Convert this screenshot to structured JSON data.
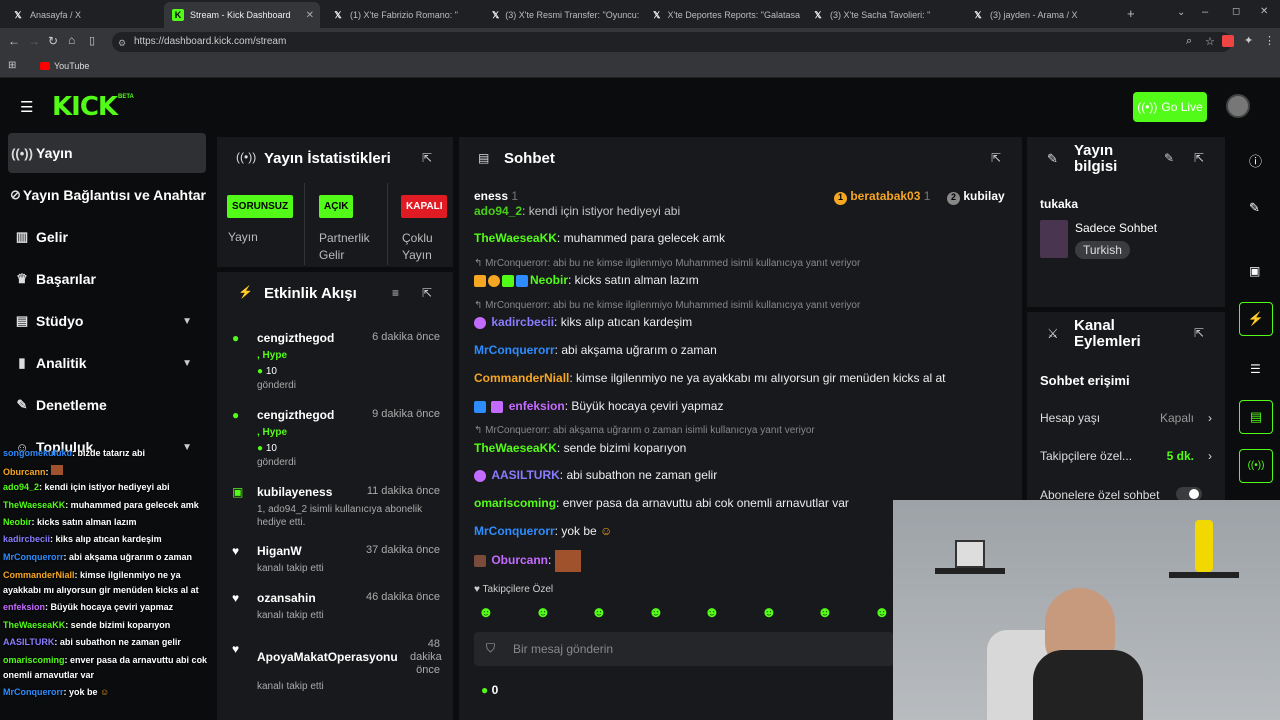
{
  "browser": {
    "tabs": [
      {
        "label": "Anasayfa / X",
        "icon": "x-logo"
      },
      {
        "label": "Stream - Kick Dashboard",
        "icon": "kick-logo"
      },
      {
        "label": "(1) X'te Fabrizio Romano: \"",
        "icon": "x-logo"
      },
      {
        "label": "(3) X'te Resmi Transfer: \"Oyuncu: Ej",
        "icon": "x-logo"
      },
      {
        "label": "X'te Deportes Reports: \"Galatasa",
        "icon": "x-logo"
      },
      {
        "label": "(3) X'te Sacha Tavolieri: \"",
        "icon": "x-logo"
      },
      {
        "label": "(3) jayden - Arama / X",
        "icon": "x-logo"
      }
    ],
    "url": "https://dashboard.kick.com/stream",
    "bookmark": "YouTube"
  },
  "header": {
    "logo": "KICK",
    "beta": "BETA",
    "go_live": "Go Live"
  },
  "sidebar": {
    "items": [
      {
        "label": "Yayın",
        "icon": "broadcast-icon"
      },
      {
        "label": "Yayın Bağlantısı ve Anahtar",
        "icon": "link-icon"
      },
      {
        "label": "Gelir",
        "icon": "bank-icon"
      },
      {
        "label": "Başarılar",
        "icon": "trophy-icon"
      },
      {
        "label": "Stüdyo",
        "icon": "wrench-icon"
      },
      {
        "label": "Analitik",
        "icon": "chart-icon"
      },
      {
        "label": "Denetleme",
        "icon": "sword-icon"
      },
      {
        "label": "Topluluk",
        "icon": "people-icon"
      }
    ]
  },
  "stats": {
    "title": "Yayın İstatistikleri",
    "badges": [
      {
        "badge": "SORUNSUZ",
        "label": "Yayın",
        "color": "#53fc18"
      },
      {
        "badge": "AÇIK",
        "label": "Partnerlik Gelir",
        "color": "#53fc18"
      },
      {
        "badge": "KAPALI",
        "label": "Çoklu Yayın",
        "color": "#e01b24"
      }
    ]
  },
  "activity": {
    "title": "Etkinlik Akışı",
    "items": [
      {
        "name": "cengizthegod",
        "time": "6 dakika önce",
        "line1": ", Hype",
        "line2": "10",
        "line3": "gönderdi",
        "icon": "kick-coin-icon"
      },
      {
        "name": "cengizthegod",
        "time": "9 dakika önce",
        "line1": ", Hype",
        "line2": "10",
        "line3": "gönderdi",
        "icon": "kick-coin-icon"
      },
      {
        "name": "kubilayeness",
        "time": "11 dakika önce",
        "line1": "1, ado94_2 isimli kullanıcıya abonelik",
        "line2": "hediye etti.",
        "icon": "gift-icon"
      },
      {
        "name": "HiganW",
        "time": "37 dakika önce",
        "line1": "kanalı takip etti",
        "icon": "heart-icon"
      },
      {
        "name": "ozansahin",
        "time": "46 dakika önce",
        "line1": "kanalı takip etti",
        "icon": "heart-icon"
      },
      {
        "name": "ApoyaMakatOperasyonu",
        "time": "48 dakika önce",
        "line1": "kanalı takip etti",
        "icon": "heart-icon"
      }
    ]
  },
  "chat": {
    "title": "Sohbet",
    "top_bar": {
      "left": "eness",
      "left_count": "1",
      "gifter1": "beratabak03",
      "gifter1_count": "1",
      "gifter2": "kubilay"
    },
    "messages": [
      {
        "user": "ado94_2",
        "text": ": kendi için istiyor hediyeyi abi",
        "color": "#53fc18"
      },
      {
        "user": "TheWaeseaKK",
        "text": ": muhammed para gelecek amk",
        "color": "#53fc18"
      },
      {
        "reply": "MrConquerorr: abi bu ne kimse ilgilenmiyo Muhammed isimli kullanıcıya yanıt veriyor"
      },
      {
        "user": "Neobir",
        "text": ": kicks satın alman lazım",
        "color": "#53fc18"
      },
      {
        "reply": "MrConquerorr: abi bu ne kimse ilgilenmiyo Muhammed isimli kullanıcıya yanıt veriyor"
      },
      {
        "user": "kadircbecii",
        "text": ": kiks alıp atıcan kardeşim",
        "color": "#8a7cff"
      },
      {
        "user": "MrConquerorr",
        "text": ": abi akşama uğrarım o zaman",
        "color": "#2d8cff"
      },
      {
        "user": "CommanderNiall",
        "text": ": kimse ilgilenmiyo ne ya ayakkabı mı alıyorsun gir menüden kicks al at",
        "color": "#f5a623"
      },
      {
        "user": "enfeksion",
        "text": ": Büyük hocaya çeviri yapmaz",
        "color": "#c46bff"
      },
      {
        "reply": "MrConquerorr: abi akşama uğrarım o zaman isimli kullanıcıya yanıt veriyor"
      },
      {
        "user": "TheWaeseaKK",
        "text": ": sende bizimi koparıyon",
        "color": "#53fc18"
      },
      {
        "user": "AASILTURK",
        "text": ": abi subathon ne zaman gelir",
        "color": "#8a7cff"
      },
      {
        "user": "omariscoming",
        "text": ": enver pasa da arnavuttu abi cok onemli arnavutlar var",
        "color": "#53fc18"
      },
      {
        "user": "MrConquerorr",
        "text": ": yok be",
        "color": "#2d8cff"
      },
      {
        "user": "Oburcann",
        "text": ":",
        "color": "#c46bff"
      }
    ],
    "followers_only": "Takipçilere Özel",
    "input_placeholder": "Bir mesaj gönderin",
    "kicks_count": "0"
  },
  "stream_info": {
    "title": "Yayın bilgisi",
    "channel": "tukaka",
    "category": "Sadece Sohbet",
    "tag": "Turkish"
  },
  "channel_actions": {
    "title": "Kanal Eylemleri",
    "section": "Sohbet erişimi",
    "rows": [
      {
        "label": "Hesap yaşı",
        "value": "Kapalı"
      },
      {
        "label": "Takipçilere özel...",
        "value": "5 dk."
      },
      {
        "label": "Abonelere özel sohbet",
        "value": ""
      }
    ]
  },
  "overlay_chat": [
    {
      "user": "songomekuluku",
      "text": ": bizde tatarız abi"
    },
    {
      "user": "Oburcann",
      "text": ":"
    },
    {
      "user": "ado94_2",
      "text": ": kendi için istiyor hediyeyi abi"
    },
    {
      "user": "TheWaeseaKK",
      "text": ": muhammed para gelecek amk"
    },
    {
      "user": "Neobir",
      "text": ": kicks satın alman lazım"
    },
    {
      "user": "kadircbecii",
      "text": ": kiks alıp atıcan kardeşim"
    },
    {
      "user": "MrConquerorr",
      "text": ": abi akşama uğrarım o zaman"
    },
    {
      "user": "CommanderNiall",
      "text": ": kimse ilgilenmiyo ne ya"
    },
    {
      "user": "",
      "text": "ayakkabı mı alıyorsun gir menüden kicks al at"
    },
    {
      "user": "enfeksion",
      "text": ": Büyük hocaya çeviri yapmaz"
    },
    {
      "user": "TheWaeseaKK",
      "text": ": sende bizimi koparıyon"
    },
    {
      "user": "AASILTURK",
      "text": ": abi subathon ne zaman gelir"
    },
    {
      "user": "omariscoming",
      "text": ": enver pasa da arnavuttu abi cok"
    },
    {
      "user": "",
      "text": "onemli arnavutlar var"
    },
    {
      "user": "MrConquerorr",
      "text": ": yok be"
    }
  ]
}
